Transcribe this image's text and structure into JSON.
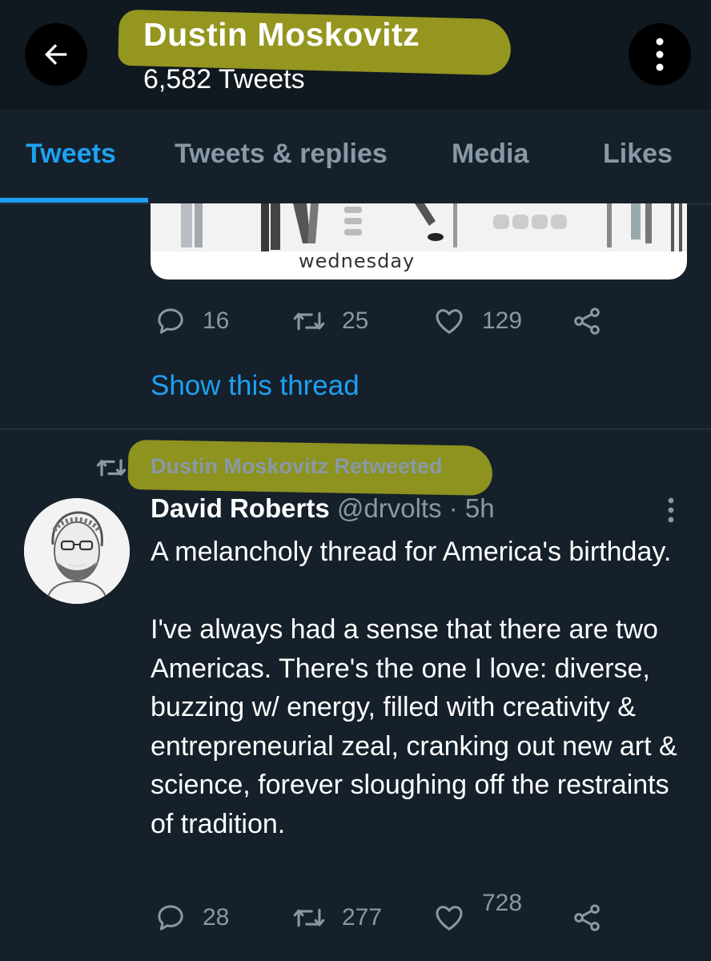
{
  "header": {
    "title": "Dustin Moskovitz",
    "subtitle": "6,582 Tweets",
    "back_icon": "arrow-left-icon",
    "more_icon": "more-vertical-icon",
    "highlight_color": "#c8c81e"
  },
  "tabs": [
    {
      "label": "Tweets",
      "active": true
    },
    {
      "label": "Tweets & replies",
      "active": false
    },
    {
      "label": "Media",
      "active": false
    },
    {
      "label": "Likes",
      "active": false
    }
  ],
  "first_tweet": {
    "card_caption": "wednesday",
    "replies": "16",
    "retweets": "25",
    "likes": "129",
    "show_thread": "Show this thread"
  },
  "retweet": {
    "label": "Dustin Moskovitz Retweeted",
    "author_name": "David Roberts",
    "author_handle": "@drvolts · 5h",
    "text": "A melancholy thread for America's birthday.\n\nI've always had a sense that there are two Americas. There's the one I love: diverse, buzzing w/ energy, filled with creativity & entrepreneurial zeal, cranking out new art & science, forever sloughing off the restraints of tradition.",
    "replies": "28",
    "retweets": "277",
    "likes": "728"
  },
  "colors": {
    "background": "#15202b",
    "header_background": "#101820",
    "accent": "#1da1f2",
    "muted": "#8899a6"
  }
}
